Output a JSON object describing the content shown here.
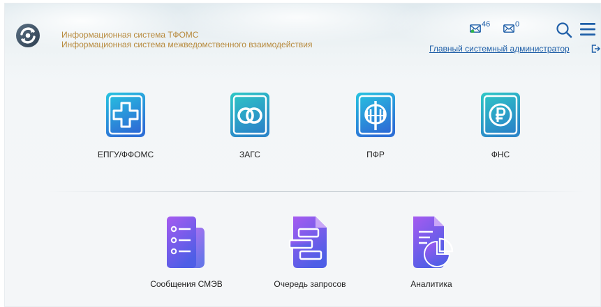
{
  "header": {
    "system_title": "Информационная система ТФОМС",
    "system_subtitle": "Информационная система межведомственного взаимодействия",
    "inbox_count": "46",
    "outbox_count": "0",
    "user_link": "Главный системный администратор"
  },
  "tiles": [
    {
      "label": "ЕПГУ/ФФОМС",
      "icon": "medical-cross-icon"
    },
    {
      "label": "ЗАГС",
      "icon": "rings-icon"
    },
    {
      "label": "ПФР",
      "icon": "pfr-emblem-icon"
    },
    {
      "label": "ФНС",
      "icon": "ruble-icon"
    }
  ],
  "tiles_row2": [
    {
      "label": "Сообщения СМЭВ",
      "icon": "messages-list-icon"
    },
    {
      "label": "Очередь запросов",
      "icon": "queue-document-icon"
    },
    {
      "label": "Аналитика",
      "icon": "analytics-report-icon"
    }
  ],
  "colors": {
    "title": "#b7893b",
    "link": "#1f5fa8",
    "gov_gradient_start": "#27c4e0",
    "gov_gradient_end": "#2d6fd6",
    "tool_gradient_start": "#a65bf0",
    "tool_gradient_end": "#4e5ee6"
  }
}
